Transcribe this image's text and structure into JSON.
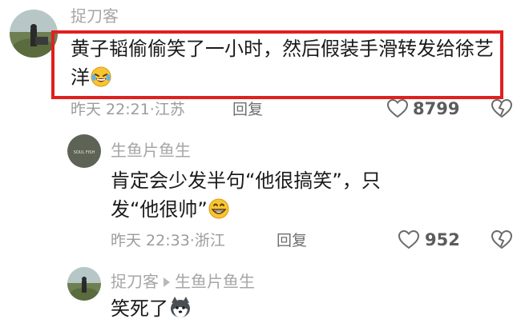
{
  "comments": [
    {
      "username": "捉刀客",
      "text": "黄子韬偷偷笑了一小时，然后假装手滑转发给徐艺洋",
      "emoji": "rolling-laugh-emoji",
      "time": "昨天 22:21",
      "location": "江苏",
      "reply_label": "回复",
      "likes": "8799"
    },
    {
      "username": "生鱼片鱼生",
      "avatar_text": "SOUL FISH",
      "text": "肯定会少发半句“他很搞笑”，只发“他很帅”",
      "emoji": "grin-emoji",
      "time": "昨天 22:33",
      "location": "浙江",
      "reply_label": "回复",
      "likes": "952"
    },
    {
      "username": "捉刀客",
      "reply_to": "生鱼片鱼生",
      "text": "笑死了",
      "emoji": "husky-emoji"
    }
  ],
  "colors": {
    "highlight": "#e11f1f"
  }
}
